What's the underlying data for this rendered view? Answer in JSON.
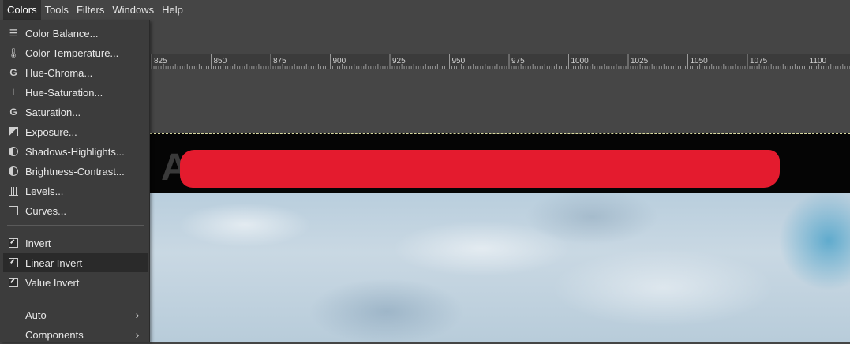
{
  "menubar": {
    "items": [
      {
        "label": "Colors"
      },
      {
        "label": "Tools"
      },
      {
        "label": "Filters"
      },
      {
        "label": "Windows"
      },
      {
        "label": "Help"
      }
    ]
  },
  "ruler": {
    "ticks": [
      "825",
      "850",
      "875",
      "900",
      "925",
      "950",
      "975",
      "1000",
      "1025",
      "1050",
      "1075",
      "1100"
    ]
  },
  "image": {
    "letter": "A"
  },
  "colors_menu": {
    "group1": [
      {
        "label": "Color Balance...",
        "icon": "color-balance-icon"
      },
      {
        "label": "Color Temperature...",
        "icon": "color-temperature-icon"
      },
      {
        "label": "Hue-Chroma...",
        "icon": "hue-chroma-icon"
      },
      {
        "label": "Hue-Saturation...",
        "icon": "hue-saturation-icon"
      },
      {
        "label": "Saturation...",
        "icon": "saturation-icon"
      },
      {
        "label": "Exposure...",
        "icon": "exposure-icon"
      },
      {
        "label": "Shadows-Highlights...",
        "icon": "shadows-highlights-icon"
      },
      {
        "label": "Brightness-Contrast...",
        "icon": "brightness-contrast-icon"
      },
      {
        "label": "Levels...",
        "icon": "levels-icon"
      },
      {
        "label": "Curves...",
        "icon": "curves-icon"
      }
    ],
    "group2": [
      {
        "label": "Invert",
        "icon": "invert-icon"
      },
      {
        "label": "Linear Invert",
        "icon": "linear-invert-icon",
        "highlighted": true
      },
      {
        "label": "Value Invert",
        "icon": "value-invert-icon"
      }
    ],
    "group3": [
      {
        "label": "Auto",
        "submenu": true
      },
      {
        "label": "Components",
        "submenu": true
      }
    ]
  },
  "colors": {
    "background": "#454545",
    "menu_bg": "#3c3c3c",
    "highlight": "#2a2a2a",
    "redaction": "#e41b2e"
  }
}
